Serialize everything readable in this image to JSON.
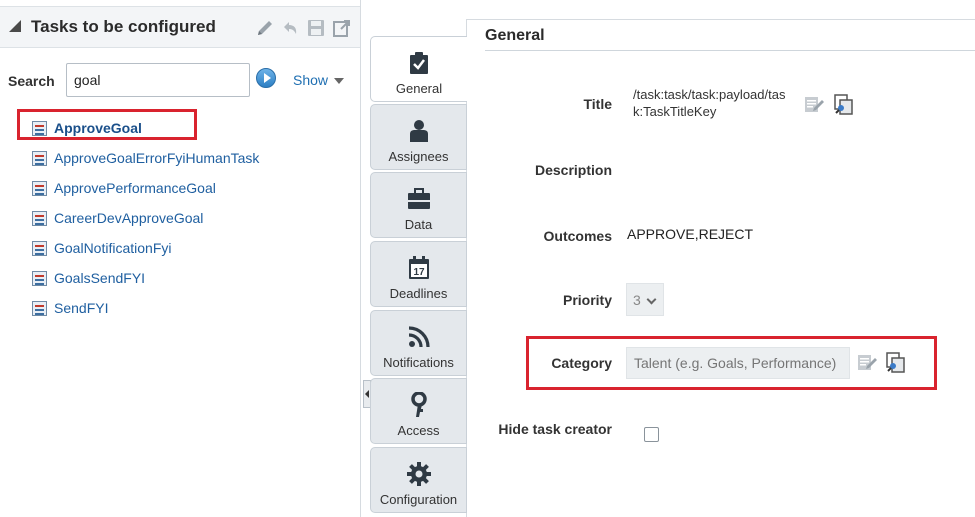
{
  "left_panel": {
    "title": "Tasks to be configured",
    "search_label": "Search",
    "search_value": "goal",
    "show_label": "Show",
    "tasks": [
      {
        "label": "ApproveGoal",
        "selected": true
      },
      {
        "label": "ApproveGoalErrorFyiHumanTask",
        "selected": false
      },
      {
        "label": "ApprovePerformanceGoal",
        "selected": false
      },
      {
        "label": "CareerDevApproveGoal",
        "selected": false
      },
      {
        "label": "GoalNotificationFyi",
        "selected": false
      },
      {
        "label": "GoalsSendFYI",
        "selected": false
      },
      {
        "label": "SendFYI",
        "selected": false
      }
    ]
  },
  "tabs": [
    {
      "label": "General",
      "icon": "clipboard-check-icon",
      "active": true
    },
    {
      "label": "Assignees",
      "icon": "person-icon",
      "active": false
    },
    {
      "label": "Data",
      "icon": "briefcase-icon",
      "active": false
    },
    {
      "label": "Deadlines",
      "icon": "calendar-icon",
      "active": false
    },
    {
      "label": "Notifications",
      "icon": "rss-icon",
      "active": false
    },
    {
      "label": "Access",
      "icon": "key-icon",
      "active": false
    },
    {
      "label": "Configuration",
      "icon": "gear-icon",
      "active": false
    }
  ],
  "calendar_day": "17",
  "general": {
    "section_title": "General",
    "title_label": "Title",
    "title_value": "/task:task/task:payload/task:TaskTitleKey",
    "description_label": "Description",
    "outcomes_label": "Outcomes",
    "outcomes_value": "APPROVE,REJECT",
    "priority_label": "Priority",
    "priority_value": "3",
    "category_label": "Category",
    "category_placeholder": "Talent (e.g. Goals, Performance)",
    "hide_creator_label": "Hide task creator"
  },
  "colors": {
    "highlight_red": "#d9232e",
    "link_blue": "#1f5fa0"
  }
}
